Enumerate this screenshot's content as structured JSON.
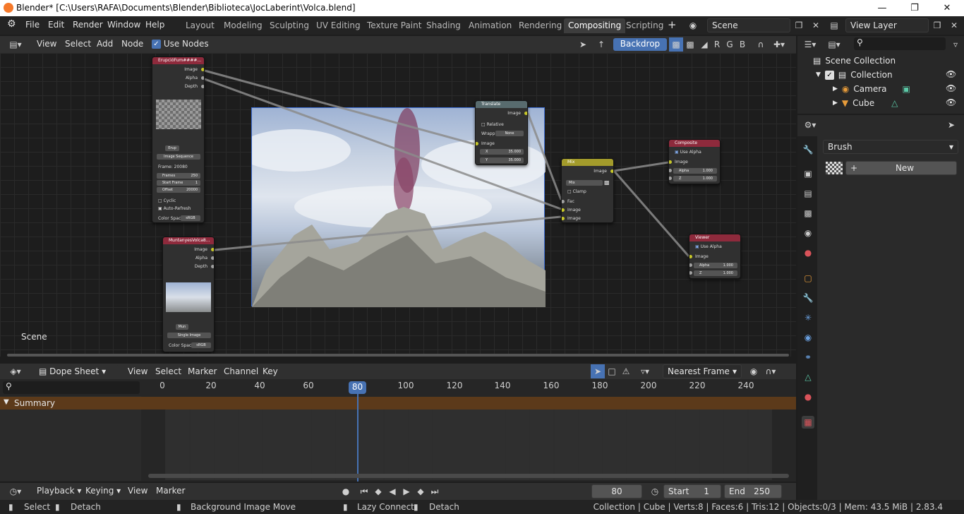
{
  "window": {
    "title": "Blender* [C:\\Users\\RAFA\\Documents\\Blender\\Biblioteca\\JocLaberint\\Volca.blend]"
  },
  "menu": [
    "File",
    "Edit",
    "Render",
    "Window",
    "Help"
  ],
  "workspaces": [
    "Layout",
    "Modeling",
    "Sculpting",
    "UV Editing",
    "Texture Paint",
    "Shading",
    "Animation",
    "Rendering",
    "Compositing",
    "Scripting"
  ],
  "active_workspace": "Compositing",
  "scene_field": "Scene",
  "view_layer_field": "View Layer",
  "node_header": {
    "menus": [
      "View",
      "Select",
      "Add",
      "Node"
    ],
    "use_nodes": "Use Nodes",
    "backdrop": "Backdrop"
  },
  "node_editor": {
    "scene_label": "Scene"
  },
  "nodes": {
    "erupcio": {
      "title": "ErupcióFum####...",
      "outputs": [
        "Image",
        "Alpha",
        "Depth"
      ],
      "file": "Erup",
      "source": "Image Sequence",
      "frame": "Frame: 20080",
      "frames_label": "Frames",
      "frames": "250",
      "start_label": "Start Frame",
      "start": "1",
      "offset_label": "Offset",
      "offset": "20000",
      "cyclic": "Cyclic",
      "auto_refresh": "Auto-Refresh",
      "colorspace_label": "Color Spac",
      "colorspace": "sRGB"
    },
    "muntanyes": {
      "title": "MuntanyesVolca8...",
      "outputs": [
        "Image",
        "Alpha",
        "Depth"
      ],
      "file": "Mun",
      "source": "Single Image",
      "colorspace_label": "Color Spac",
      "colorspace": "sRGB"
    },
    "translate": {
      "title": "Translate",
      "output": "Image",
      "relative": "Relative",
      "wrap_label": "Wrapp",
      "wrap": "None",
      "input": "Image",
      "x_label": "X",
      "x": "35.000",
      "y_label": "Y",
      "y": "35.000"
    },
    "mix": {
      "title": "Mix",
      "output": "Image",
      "blend": "Mix",
      "clamp": "Clamp",
      "inputs": [
        "Fac",
        "Image",
        "Image"
      ]
    },
    "composite": {
      "title": "Composite",
      "use_alpha": "Use Alpha",
      "input": "Image",
      "alpha_label": "Alpha",
      "alpha": "1.000",
      "z_label": "Z",
      "z": "1.000"
    },
    "viewer": {
      "title": "Viewer",
      "use_alpha": "Use Alpha",
      "input": "Image",
      "alpha_label": "Alpha",
      "alpha": "1.000",
      "z_label": "Z",
      "z": "1.000"
    }
  },
  "dopesheet": {
    "mode": "Dope Sheet",
    "menus": [
      "View",
      "Select",
      "Marker",
      "Channel",
      "Key"
    ],
    "snap": "Nearest Frame",
    "summary": "Summary",
    "ticks": [
      "0",
      "20",
      "40",
      "60",
      "80",
      "100",
      "120",
      "140",
      "160",
      "180",
      "200",
      "220",
      "240"
    ],
    "current_frame_marker": "80"
  },
  "playback": {
    "menus": [
      "Playback",
      "Keying",
      "View",
      "Marker"
    ],
    "current_frame": "80",
    "start_label": "Start",
    "start": "1",
    "end_label": "End",
    "end": "250"
  },
  "outliner": {
    "root": "Scene Collection",
    "collection": "Collection",
    "items": [
      "Camera",
      "Cube"
    ]
  },
  "properties": {
    "brush_label": "Brush",
    "new_button": "New"
  },
  "status": {
    "select": "Select",
    "detach1": "Detach",
    "bg_move": "Background Image Move",
    "lazy": "Lazy Connect",
    "detach2": "Detach",
    "info": "Collection | Cube | Verts:8 | Faces:6 | Tris:12 | Objects:0/3 | Mem: 43.5 MiB | 2.83.4"
  },
  "colors": {
    "accent": "#4772b3",
    "image_socket": "#c7c729",
    "image_node": "#8e2a3c",
    "mix_node": "#a39b2b",
    "translate_node": "#586b6e",
    "summary_row": "#5c3a1a"
  }
}
